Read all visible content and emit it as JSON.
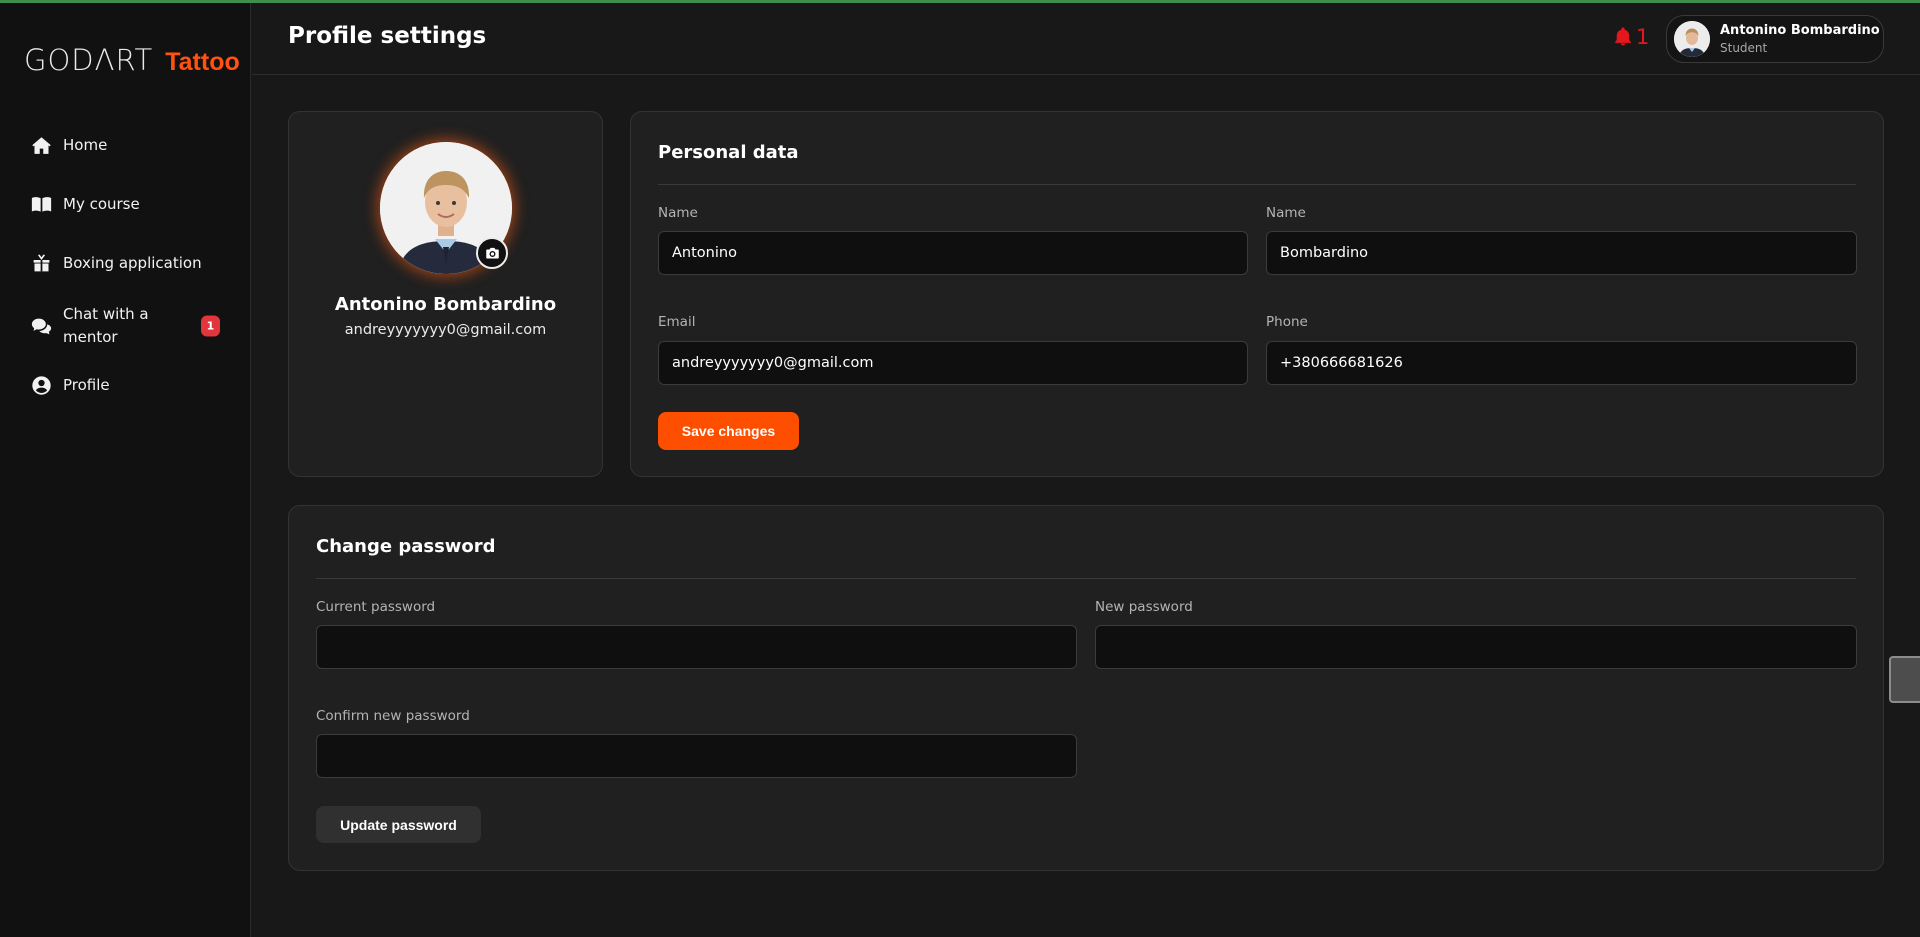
{
  "brand": {
    "logo_main": "GODΛRT",
    "logo_sub": "Tattoo"
  },
  "header": {
    "title": "Profile settings",
    "notification_count": "1",
    "user": {
      "name": "Antonino Bombardino",
      "role": "Student"
    }
  },
  "sidebar": {
    "items": [
      {
        "label": "Home",
        "icon": "home-icon"
      },
      {
        "label": "My course",
        "icon": "book-icon"
      },
      {
        "label": "Boxing application",
        "icon": "box-icon"
      },
      {
        "label": "Chat with a mentor",
        "icon": "chat-icon",
        "badge": "1"
      },
      {
        "label": "Profile",
        "icon": "user-circle-icon"
      }
    ]
  },
  "profile": {
    "name": "Antonino Bombardino",
    "email": "andreyyyyyyy0@gmail.com"
  },
  "personal": {
    "title": "Personal data",
    "first_name_label": "Name",
    "first_name": "Antonino",
    "last_name_label": "Name",
    "last_name": "Bombardino",
    "email_label": "Email",
    "email": "andreyyyyyyy0@gmail.com",
    "phone_label": "Phone",
    "phone": "+380666681626",
    "save_label": "Save changes"
  },
  "password": {
    "title": "Change password",
    "current_label": "Current password",
    "current_value": "",
    "new_label": "New password",
    "new_value": "",
    "confirm_label": "Confirm new password",
    "confirm_value": "",
    "update_label": "Update password"
  },
  "colors": {
    "accent": "#fe4e00",
    "notification": "#e3171d",
    "badge": "#e2353c",
    "background": "#181818",
    "sidebar": "#111111",
    "card": "#202020"
  }
}
